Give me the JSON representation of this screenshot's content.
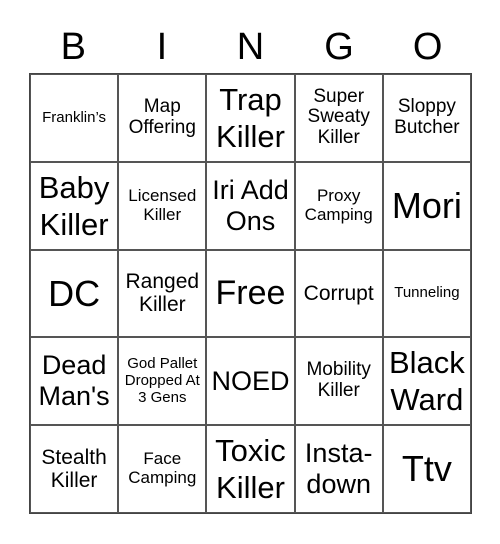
{
  "header": {
    "letters": [
      "B",
      "I",
      "N",
      "G",
      "O"
    ]
  },
  "cells": [
    [
      "Franklin’s",
      "Map Offering",
      "Trap Killer",
      "Super Sweaty Killer",
      "Sloppy Butcher"
    ],
    [
      "Baby Killer",
      "Licensed Killer",
      "Iri Add Ons",
      "Proxy Camping",
      "Mori"
    ],
    [
      "DC",
      "Ranged Killer",
      "Free",
      "Corrupt",
      "Tunneling"
    ],
    [
      "Dead Man's",
      "God Pallet Dropped At 3 Gens",
      "NOED",
      "Mobility Killer",
      "Black Ward"
    ],
    [
      "Stealth Killer",
      "Face Camping",
      "Toxic Killer",
      "Insta-down",
      "Ttv"
    ]
  ]
}
